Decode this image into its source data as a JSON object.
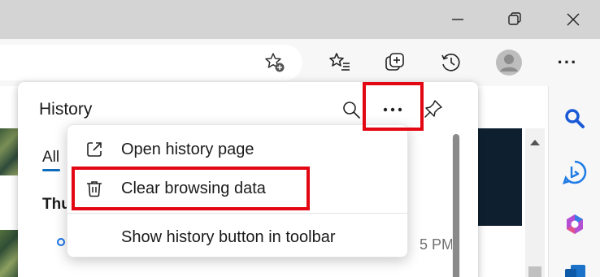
{
  "history": {
    "title": "History",
    "tabs": [
      {
        "label": "All"
      }
    ],
    "date_group": "Thu",
    "entry_time": "5 PM"
  },
  "menu": {
    "items": [
      {
        "label": "Open history page",
        "icon": "open-external-icon"
      },
      {
        "label": "Clear browsing data",
        "icon": "trash-icon"
      },
      {
        "label": "Show history button in toolbar",
        "icon": ""
      }
    ]
  },
  "toolbar": {
    "more_label": "···",
    "icons": [
      "favorite-add-icon",
      "favorites-icon",
      "collections-icon",
      "history-icon",
      "profile-icon",
      "more-icon"
    ]
  },
  "sidebar": {
    "icons": [
      "search-icon",
      "bing-icon",
      "copilot-icon",
      "outlook-icon"
    ]
  },
  "highlight_color": "#e30613",
  "accent_color": "#0f6cbd"
}
